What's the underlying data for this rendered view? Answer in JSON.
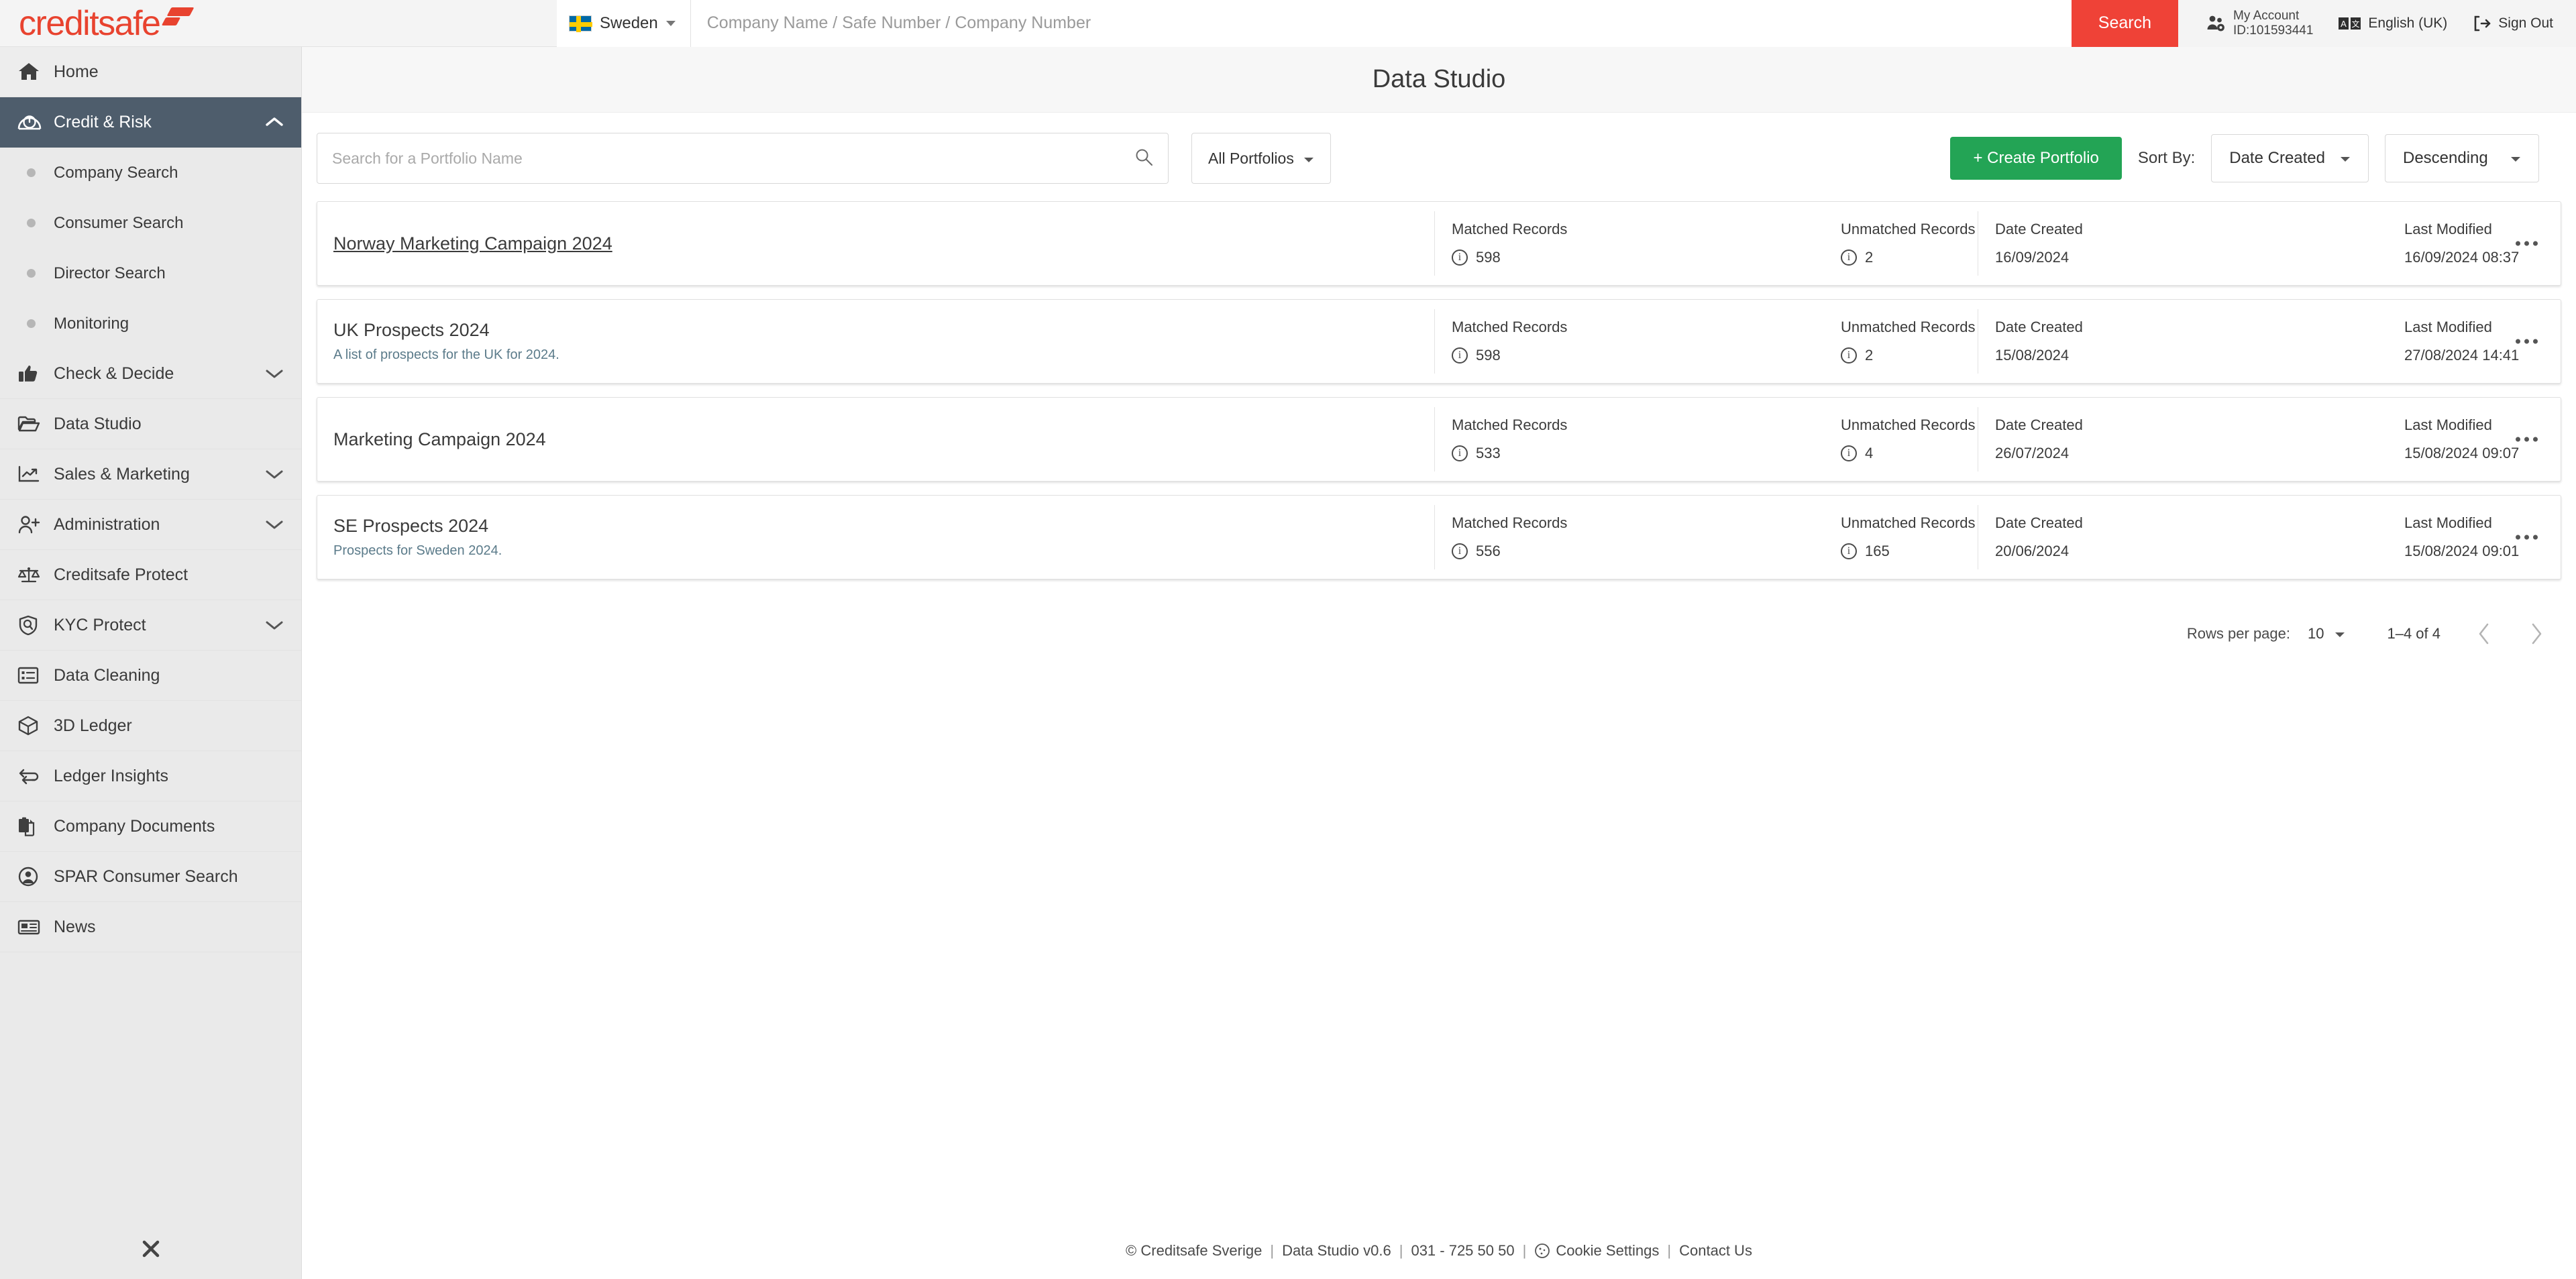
{
  "brand": {
    "logo_text": "creditsafe",
    "accent_red": "#ef4237",
    "accent_green": "#23a455",
    "sidebar_active_bg": "#4e5d6c"
  },
  "header": {
    "country": "Sweden",
    "search_placeholder": "Company Name / Safe Number / Company Number",
    "search_value": "",
    "search_button": "Search",
    "account_label": "My Account",
    "account_id": "ID:101593441",
    "language": "English (UK)",
    "signout": "Sign Out"
  },
  "sidebar": {
    "items": [
      {
        "label": "Home",
        "icon": "home-icon",
        "type": "item",
        "active": false
      },
      {
        "label": "Credit & Risk",
        "icon": "gauge-icon",
        "type": "expandable",
        "active": true,
        "chevron": "up"
      },
      {
        "label": "Company Search",
        "icon": "bullet-icon",
        "type": "sub"
      },
      {
        "label": "Consumer Search",
        "icon": "bullet-icon",
        "type": "sub"
      },
      {
        "label": "Director Search",
        "icon": "bullet-icon",
        "type": "sub"
      },
      {
        "label": "Monitoring",
        "icon": "bullet-icon",
        "type": "sub"
      },
      {
        "label": "Check & Decide",
        "icon": "thumbs-up-icon",
        "type": "expandable",
        "chevron": "down"
      },
      {
        "label": "Data Studio",
        "icon": "folder-open-icon",
        "type": "item"
      },
      {
        "label": "Sales & Marketing",
        "icon": "trending-up-icon",
        "type": "expandable",
        "chevron": "down"
      },
      {
        "label": "Administration",
        "icon": "user-plus-icon",
        "type": "expandable",
        "chevron": "down"
      },
      {
        "label": "Creditsafe Protect",
        "icon": "scales-icon",
        "type": "item"
      },
      {
        "label": "KYC Protect",
        "icon": "shield-search-icon",
        "type": "expandable",
        "chevron": "down"
      },
      {
        "label": "Data Cleaning",
        "icon": "list-icon",
        "type": "item"
      },
      {
        "label": "3D Ledger",
        "icon": "cube-icon",
        "type": "item"
      },
      {
        "label": "Ledger Insights",
        "icon": "swap-arrows-icon",
        "type": "item"
      },
      {
        "label": "Company Documents",
        "icon": "documents-icon",
        "type": "item"
      },
      {
        "label": "SPAR Consumer Search",
        "icon": "user-circle-icon",
        "type": "item"
      },
      {
        "label": "News",
        "icon": "newspaper-icon",
        "type": "item"
      }
    ],
    "collapse_icon": "close-icon"
  },
  "page": {
    "title": "Data Studio"
  },
  "toolbar": {
    "search_placeholder": "Search for a Portfolio Name",
    "search_value": "",
    "filter_label": "All Portfolios",
    "create_label": "+ Create Portfolio",
    "sort_by_label": "Sort By:",
    "sort_field": "Date Created",
    "sort_direction": "Descending"
  },
  "columns": {
    "matched": "Matched Records",
    "unmatched": "Unmatched Records",
    "created": "Date Created",
    "modified": "Last Modified"
  },
  "portfolios": [
    {
      "name": "Norway Marketing Campaign 2024",
      "description": "",
      "linked": true,
      "matched": "598",
      "unmatched": "2",
      "created": "16/09/2024",
      "modified": "16/09/2024 08:37"
    },
    {
      "name": "UK Prospects 2024",
      "description": "A list of prospects for the UK for 2024.",
      "linked": false,
      "matched": "598",
      "unmatched": "2",
      "created": "15/08/2024",
      "modified": "27/08/2024 14:41"
    },
    {
      "name": "Marketing Campaign 2024",
      "description": "",
      "linked": false,
      "matched": "533",
      "unmatched": "4",
      "created": "26/07/2024",
      "modified": "15/08/2024 09:07"
    },
    {
      "name": "SE Prospects 2024",
      "description": "Prospects for Sweden 2024.",
      "linked": false,
      "matched": "556",
      "unmatched": "165",
      "created": "20/06/2024",
      "modified": "15/08/2024 09:01"
    }
  ],
  "pagination": {
    "rows_per_page_label": "Rows per page:",
    "rows_per_page_value": "10",
    "range": "1–4 of 4"
  },
  "footer": {
    "copyright": "© Creditsafe Sverige",
    "version": "Data Studio v0.6",
    "phone": "031 - 725 50 50",
    "cookie_settings": "Cookie Settings",
    "contact": "Contact Us"
  }
}
